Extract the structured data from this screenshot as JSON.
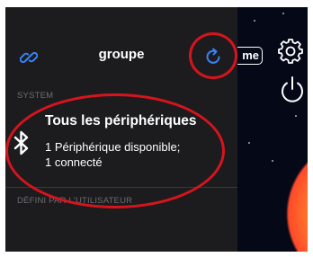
{
  "header": {
    "title": "groupe"
  },
  "sections": {
    "system_label": "SYSTEM",
    "user_label": "DÉFINI PAR L'UTILISATEUR"
  },
  "device_group": {
    "title": "Tous les périphériques",
    "line1": "1 Périphérique disponible;",
    "line2": "1 connecté"
  },
  "background_app": {
    "name_chip": "me"
  },
  "icons": {
    "link": "link-icon",
    "refresh": "refresh-icon",
    "bluetooth": "bluetooth-icon",
    "settings": "gear-icon",
    "power": "power-icon"
  },
  "colors": {
    "panel_bg": "#1c1c1e",
    "accent_blue": "#3a82f7",
    "annotation_red": "#d7141d",
    "section_gray": "#6e6e73"
  }
}
